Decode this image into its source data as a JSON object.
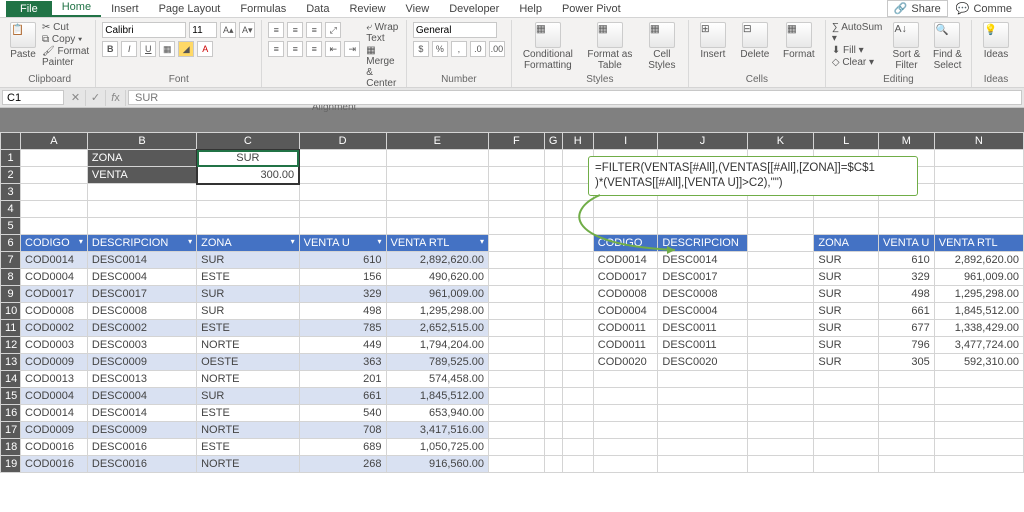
{
  "tabs": {
    "file": "File",
    "home": "Home",
    "insert": "Insert",
    "page_layout": "Page Layout",
    "formulas": "Formulas",
    "data": "Data",
    "review": "Review",
    "view": "View",
    "developer": "Developer",
    "help": "Help",
    "power_pivot": "Power Pivot",
    "share": "Share",
    "comments": "Comme"
  },
  "ribbon": {
    "clipboard": {
      "paste": "Paste",
      "cut": "Cut",
      "copy": "Copy",
      "format_painter": "Format Painter",
      "label": "Clipboard"
    },
    "font": {
      "name": "Calibri",
      "size": "11",
      "label": "Font"
    },
    "alignment": {
      "wrap": "Wrap Text",
      "merge": "Merge & Center",
      "label": "Alignment"
    },
    "number": {
      "format": "General",
      "label": "Number"
    },
    "styles": {
      "cond": "Conditional\nFormatting",
      "table": "Format as\nTable",
      "cell": "Cell\nStyles",
      "label": "Styles"
    },
    "cells": {
      "insert": "Insert",
      "delete": "Delete",
      "format": "Format",
      "label": "Cells"
    },
    "editing": {
      "autosum": "AutoSum",
      "fill": "Fill",
      "clear": "Clear",
      "sort": "Sort &\nFilter",
      "find": "Find &\nSelect",
      "label": "Editing"
    },
    "ideas": {
      "ideas": "Ideas",
      "label": "Ideas"
    }
  },
  "namebox": "C1",
  "formula_display": "SUR",
  "cols": [
    "A",
    "B",
    "C",
    "D",
    "E",
    "F",
    "G",
    "H",
    "I",
    "J",
    "K",
    "L",
    "M",
    "N"
  ],
  "inputs": {
    "zona_label": "ZONA",
    "zona_value": "SUR",
    "venta_label": "VENTA",
    "venta_value": "300.00"
  },
  "callout_line1": "=FILTER(VENTAS[#All],(VENTAS[[#All],[ZONA]]=$C$1",
  "callout_line2": ")*(VENTAS[[#All],[VENTA U]]>C2),\"\")",
  "left_headers": [
    "CODIGO",
    "DESCRIPCION",
    "ZONA",
    "VENTA U",
    "VENTA RTL"
  ],
  "left_rows": [
    {
      "r": 7,
      "c": "COD0014",
      "d": "DESC0014",
      "z": "SUR",
      "u": "610",
      "t": "2,892,620.00"
    },
    {
      "r": 8,
      "c": "COD0004",
      "d": "DESC0004",
      "z": "ESTE",
      "u": "156",
      "t": "490,620.00"
    },
    {
      "r": 9,
      "c": "COD0017",
      "d": "DESC0017",
      "z": "SUR",
      "u": "329",
      "t": "961,009.00"
    },
    {
      "r": 10,
      "c": "COD0008",
      "d": "DESC0008",
      "z": "SUR",
      "u": "498",
      "t": "1,295,298.00"
    },
    {
      "r": 11,
      "c": "COD0002",
      "d": "DESC0002",
      "z": "ESTE",
      "u": "785",
      "t": "2,652,515.00"
    },
    {
      "r": 12,
      "c": "COD0003",
      "d": "DESC0003",
      "z": "NORTE",
      "u": "449",
      "t": "1,794,204.00"
    },
    {
      "r": 13,
      "c": "COD0009",
      "d": "DESC0009",
      "z": "OESTE",
      "u": "363",
      "t": "789,525.00"
    },
    {
      "r": 14,
      "c": "COD0013",
      "d": "DESC0013",
      "z": "NORTE",
      "u": "201",
      "t": "574,458.00"
    },
    {
      "r": 15,
      "c": "COD0004",
      "d": "DESC0004",
      "z": "SUR",
      "u": "661",
      "t": "1,845,512.00"
    },
    {
      "r": 16,
      "c": "COD0014",
      "d": "DESC0014",
      "z": "ESTE",
      "u": "540",
      "t": "653,940.00"
    },
    {
      "r": 17,
      "c": "COD0009",
      "d": "DESC0009",
      "z": "NORTE",
      "u": "708",
      "t": "3,417,516.00"
    },
    {
      "r": 18,
      "c": "COD0016",
      "d": "DESC0016",
      "z": "ESTE",
      "u": "689",
      "t": "1,050,725.00"
    },
    {
      "r": 19,
      "c": "COD0016",
      "d": "DESC0016",
      "z": "NORTE",
      "u": "268",
      "t": "916,560.00"
    }
  ],
  "right_headers": [
    "CODIGO",
    "DESCRIPCION",
    "ZONA",
    "VENTA U",
    "VENTA RTL"
  ],
  "right_rows": [
    {
      "r": 7,
      "c": "COD0014",
      "d": "DESC0014",
      "z": "SUR",
      "u": "610",
      "t": "2,892,620.00"
    },
    {
      "r": 8,
      "c": "COD0017",
      "d": "DESC0017",
      "z": "SUR",
      "u": "329",
      "t": "961,009.00"
    },
    {
      "r": 9,
      "c": "COD0008",
      "d": "DESC0008",
      "z": "SUR",
      "u": "498",
      "t": "1,295,298.00"
    },
    {
      "r": 10,
      "c": "COD0004",
      "d": "DESC0004",
      "z": "SUR",
      "u": "661",
      "t": "1,845,512.00"
    },
    {
      "r": 11,
      "c": "COD0011",
      "d": "DESC0011",
      "z": "SUR",
      "u": "677",
      "t": "1,338,429.00"
    },
    {
      "r": 12,
      "c": "COD0011",
      "d": "DESC0011",
      "z": "SUR",
      "u": "796",
      "t": "3,477,724.00"
    },
    {
      "r": 13,
      "c": "COD0020",
      "d": "DESC0020",
      "z": "SUR",
      "u": "305",
      "t": "592,310.00"
    }
  ]
}
